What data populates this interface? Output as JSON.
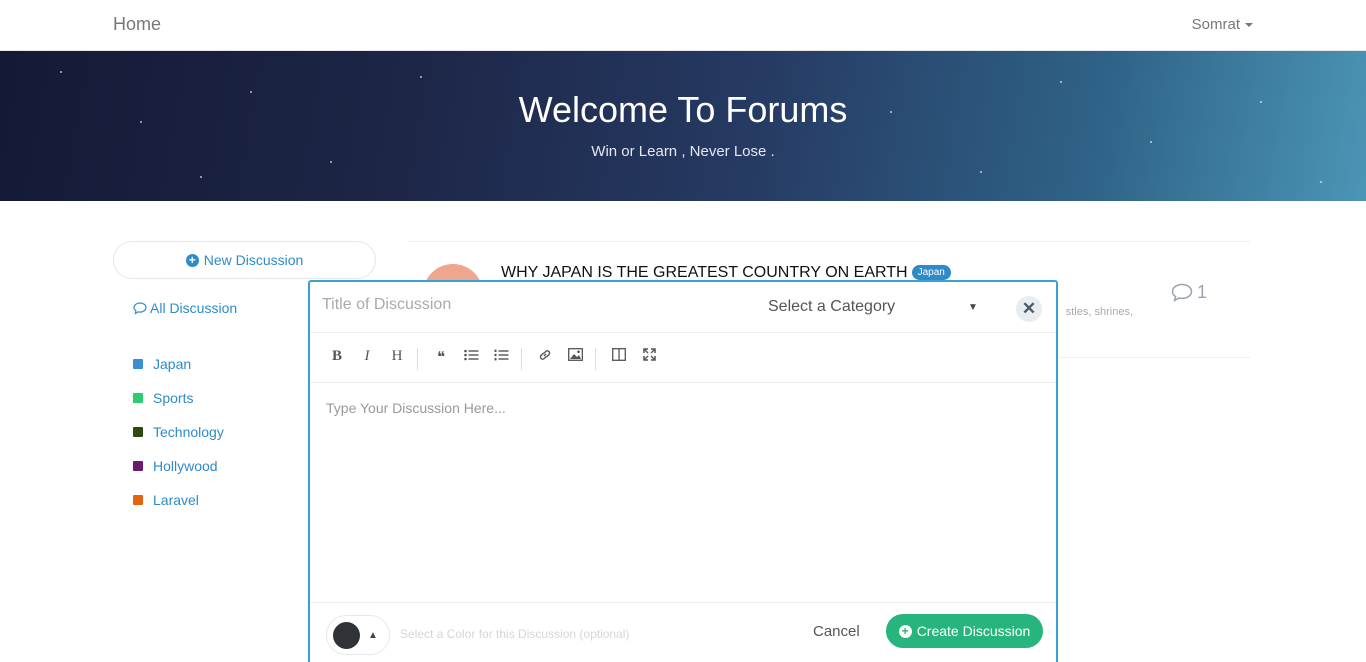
{
  "nav": {
    "home_label": "Home",
    "user_label": "Somrat"
  },
  "hero": {
    "title": "Welcome To Forums",
    "subtitle": "Win or Learn , Never Lose ."
  },
  "sidebar": {
    "new_discussion_label": "New Discussion",
    "all_discussion_label": "All Discussion",
    "categories": [
      {
        "label": "Japan",
        "color": "#3a8fd0"
      },
      {
        "label": "Sports",
        "color": "#2ecc71"
      },
      {
        "label": "Technology",
        "color": "#2c4a12"
      },
      {
        "label": "Hollywood",
        "color": "#6a1b6b"
      },
      {
        "label": "Laravel",
        "color": "#e4640f"
      }
    ]
  },
  "discussion": {
    "title": "WHY JAPAN IS THE GREATEST COUNTRY ON EARTH",
    "tag": "Japan",
    "excerpt_fragment": "stles, shrines,",
    "comment_count": "1"
  },
  "modal": {
    "title_placeholder": "Title of Discussion",
    "category_placeholder": "Select a Category",
    "body_placeholder": "Type Your Discussion Here...",
    "color_hint": "Select a Color for this Discussion (optional)",
    "cancel_label": "Cancel",
    "create_label": "Create Discussion",
    "selected_color": "#2f3337"
  },
  "toolbar": {
    "bold": "B",
    "italic": "I",
    "heading": "H"
  }
}
